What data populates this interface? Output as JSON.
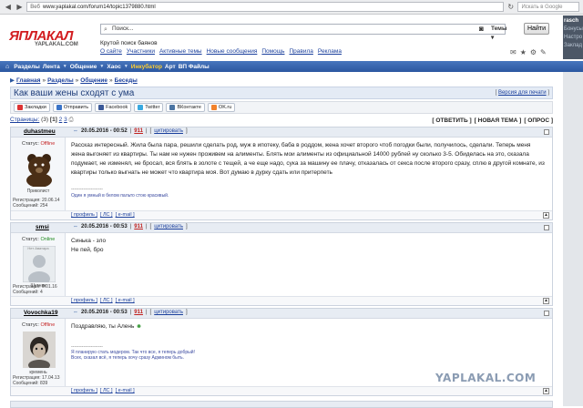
{
  "browser": {
    "url_label": "Веб",
    "url": "www.yaplakal.com/forum14/topic1379880.html",
    "search_placeholder": "Искать в Google"
  },
  "header": {
    "logo_text": "ЯПЛАКАЛ",
    "logo_sub": "YAPLAKAL.COM",
    "search_placeholder": "Поиск...",
    "search_scope": "Темы",
    "find_button": "Найти",
    "tagline": "Крутой поиск баянов",
    "links": [
      "О сайте",
      "Участники",
      "Активные темы",
      "Новые сообщения",
      "Помощь",
      "Правила",
      "Реклама"
    ],
    "right_panel": {
      "user": "rasch",
      "lines": [
        "Бонусы",
        "Настро",
        "Заклад"
      ]
    }
  },
  "nav": {
    "items": [
      {
        "label": "Разделы",
        "arrow": false,
        "highlight": false
      },
      {
        "label": "Лента",
        "arrow": true,
        "highlight": false
      },
      {
        "label": "Общение",
        "arrow": true,
        "highlight": false
      },
      {
        "label": "Хаос",
        "arrow": true,
        "highlight": false
      },
      {
        "label": "Инкубатор",
        "arrow": false,
        "highlight": true
      },
      {
        "label": "Арт",
        "arrow": false,
        "highlight": false
      },
      {
        "label": "ВП Файлы",
        "arrow": false,
        "highlight": false
      }
    ]
  },
  "breadcrumbs": [
    "Главная",
    "Разделы",
    "Общение",
    "Беседы"
  ],
  "topic": {
    "title": "Как ваши жены сходят с ума",
    "print_link": "Версия для печати"
  },
  "share": [
    "Закладки",
    "Отправить",
    "Facebook",
    "Twitter",
    "ВКонтакте",
    "OK.ru"
  ],
  "pager": {
    "label": "Страницы:",
    "count": "(3)",
    "current": "[1]",
    "others": [
      "2",
      "3"
    ],
    "actions": [
      "[ ОТВЕТИТЬ ]",
      "[ НОВАЯ ТЕМА ]",
      "[ ОПРОС ]"
    ]
  },
  "posts": [
    {
      "author": "duhastmeu",
      "date": "20.05.2016 - 00:52",
      "num": "911",
      "quote": "цитировать",
      "status_label": "Статус:",
      "status": "Offline",
      "rank": "Приколист",
      "reg": "Регистрация: 20.06.14",
      "msgs": "Сообщений: 254",
      "text": "Рассказ интересный. Жила была пара, решили сделать род, муж в ипотеку, баба в роддом, жена хочет второго чтоб погодки были, получилось, сделали. Теперь меня жена выгоняет из квартиры. Ты нам не нужен проживем на алименты. Блять мои алименты из официальной 14000 рублей ну сколько 3-5. Обиделась на это, сказала подумает, не изменял, не бросал, вся блять в золоте с тещей, а че еще надо, сука за машину ее плачу, отказалась от секса после второго сразу, сплю в другой комнате, из квартиры только выгнать не может что квартира моя. Вот думаю в дурку сдать или притерпеть",
      "sig_sep": "---------------------",
      "sig": "Один я умный в белом пальто стою красивый.",
      "foot": [
        "[ профиль ]",
        "[ ЛС ]",
        "[ e-mail ]"
      ]
    },
    {
      "author": "smsi",
      "date": "20.05.2016 - 00:53",
      "num": "911",
      "quote": "цитировать",
      "status_label": "Статус:",
      "status": "Online",
      "rank": "Шутник",
      "avatar_text": "Нет Аватара",
      "reg": "Регистрация: 9.01.16",
      "msgs": "Сообщений: 4",
      "text_lines": [
        "Синька - зло",
        "Не пей, бро"
      ],
      "foot": [
        "[ профиль ]",
        "[ ЛС ]",
        "[ e-mail ]"
      ]
    },
    {
      "author": "Vovochka19",
      "date": "20.05.2016 - 00:53",
      "num": "911",
      "quote": "цитировать",
      "status_label": "Статус:",
      "status": "Offline",
      "rank": "кремень",
      "reg": "Регистрация: 17.04.13",
      "msgs": "Сообщений: 839",
      "text": "Поздравляю, ты Алень",
      "sig_sep": "---------------------",
      "sig_lines": [
        "Я планирую стать модером. Так что все, я теперь добрый!",
        "Всех, сказал всё, я теперь хочу сразу Админом быть."
      ],
      "foot": [
        "[ профиль ]",
        "[ ЛС ]",
        "[ e-mail ]"
      ]
    }
  ],
  "watermark": "YAPLAKAL.COM"
}
